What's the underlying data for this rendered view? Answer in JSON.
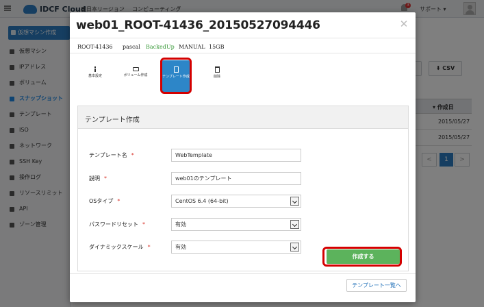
{
  "app": {
    "logo_text": "IDCF Cloud",
    "breadcrumbs": [
      {
        "label": "東日本リージョン"
      },
      {
        "label": "コンピューティング"
      }
    ],
    "notification_count": "3",
    "support_label": "サポート"
  },
  "sidebar": {
    "new_vm_label": "仮想マシン作成",
    "items": [
      {
        "label": "仮想マシン"
      },
      {
        "label": "IPアドレス"
      },
      {
        "label": "ボリューム"
      },
      {
        "label": "スナップショット",
        "active": true
      },
      {
        "label": "テンプレート"
      },
      {
        "label": "ISO"
      },
      {
        "label": "ネットワーク"
      },
      {
        "label": "SSH Key"
      },
      {
        "label": "操作ログ"
      },
      {
        "label": "リソースリミット"
      },
      {
        "label": "API"
      },
      {
        "label": "ゾーン管理"
      }
    ]
  },
  "background_table": {
    "csv_label": "CSV",
    "column_header": "作成日",
    "rows": [
      "2015/05/27",
      "2015/05/27"
    ],
    "pager": {
      "prev": "<",
      "current": "1",
      "next": ">"
    }
  },
  "modal": {
    "title": "web01_ROOT-41436_20150527094446",
    "meta": {
      "vm_id": "ROOT-41436",
      "owner": "pascal",
      "status": "BackedUp",
      "type": "MANUAL",
      "size": "15GB"
    },
    "actions": [
      {
        "label": "基本設定",
        "icon": "info-icon"
      },
      {
        "label": "ボリューム作成",
        "icon": "drive-icon"
      },
      {
        "label": "テンプレート作成",
        "icon": "file-icon",
        "active": true
      },
      {
        "label": "削除",
        "icon": "trash-icon"
      }
    ],
    "form": {
      "heading": "テンプレート作成",
      "fields": {
        "name": {
          "label": "テンプレート名",
          "value": "WebTemplate"
        },
        "description": {
          "label": "説明",
          "value": "web01のテンプレート"
        },
        "os_type": {
          "label": "OSタイプ",
          "value": "CentOS 6.4 (64-bit)"
        },
        "password_reset": {
          "label": "パスワードリセット",
          "value": "有効"
        },
        "dynamic_scale": {
          "label": "ダイナミックスケール",
          "value": "有効"
        }
      },
      "required_mark": "*",
      "submit_label": "作成する"
    },
    "template_list_label": "テンプレート一覧へ"
  },
  "colors": {
    "accent": "#2d86c8",
    "success": "#5cb35c",
    "highlight": "#d40000",
    "status_green": "#3a9a3a"
  }
}
